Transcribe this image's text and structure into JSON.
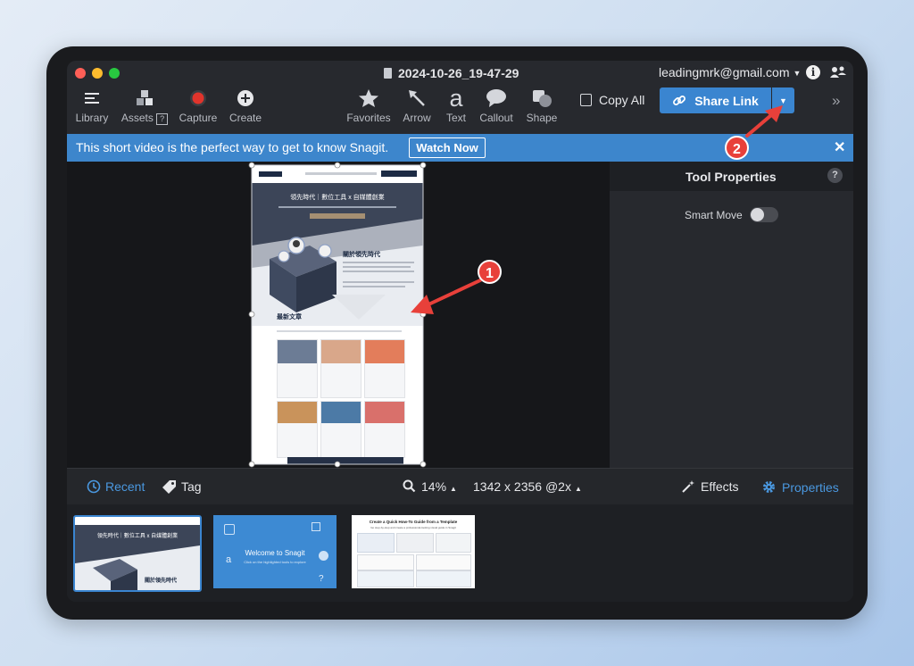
{
  "window": {
    "title": "2024-10-26_19-47-29",
    "account": "leadingmrk@gmail.com"
  },
  "toolbar": {
    "library": "Library",
    "assets": "Assets",
    "assets_badge": "?",
    "capture": "Capture",
    "create": "Create",
    "favorites": "Favorites",
    "arrow": "Arrow",
    "text": "Text",
    "text_glyph": "a",
    "callout": "Callout",
    "shape": "Shape",
    "copy_all": "Copy All",
    "share_link": "Share Link",
    "more": "»"
  },
  "banner": {
    "text": "This short video is the perfect way to get to know Snagit.",
    "button": "Watch Now",
    "close": "✕"
  },
  "capture_preview": {
    "hero_title": "領先時代｜數位工具 x 自媒體創業",
    "about_title": "關於領先時代",
    "articles_title": "最新文章"
  },
  "properties_panel": {
    "title": "Tool Properties",
    "help": "?",
    "smart_move_label": "Smart Move",
    "smart_move_on": false
  },
  "bottom_bar": {
    "recent": "Recent",
    "tag": "Tag",
    "zoom": "14%",
    "dimensions": "1342 x 2356 @2x",
    "effects": "Effects",
    "properties": "Properties"
  },
  "tray": {
    "items": [
      {
        "caption": "領先時代｜數位工具 x 自媒體創業",
        "sub": "關於領先時代"
      },
      {
        "caption": "Welcome to Snagit",
        "sub": "Click on the highlighted tools to explore"
      },
      {
        "caption": "Create a Quick How-To Guide from a Template",
        "sub": "Go step-by-step and create a professional-looking visual guide in Snagit"
      }
    ]
  },
  "annotations": {
    "badge1": "1",
    "badge2": "2"
  },
  "colors": {
    "accent": "#3a85d0",
    "banner": "#3d86cc",
    "annotation": "#e8403a"
  }
}
